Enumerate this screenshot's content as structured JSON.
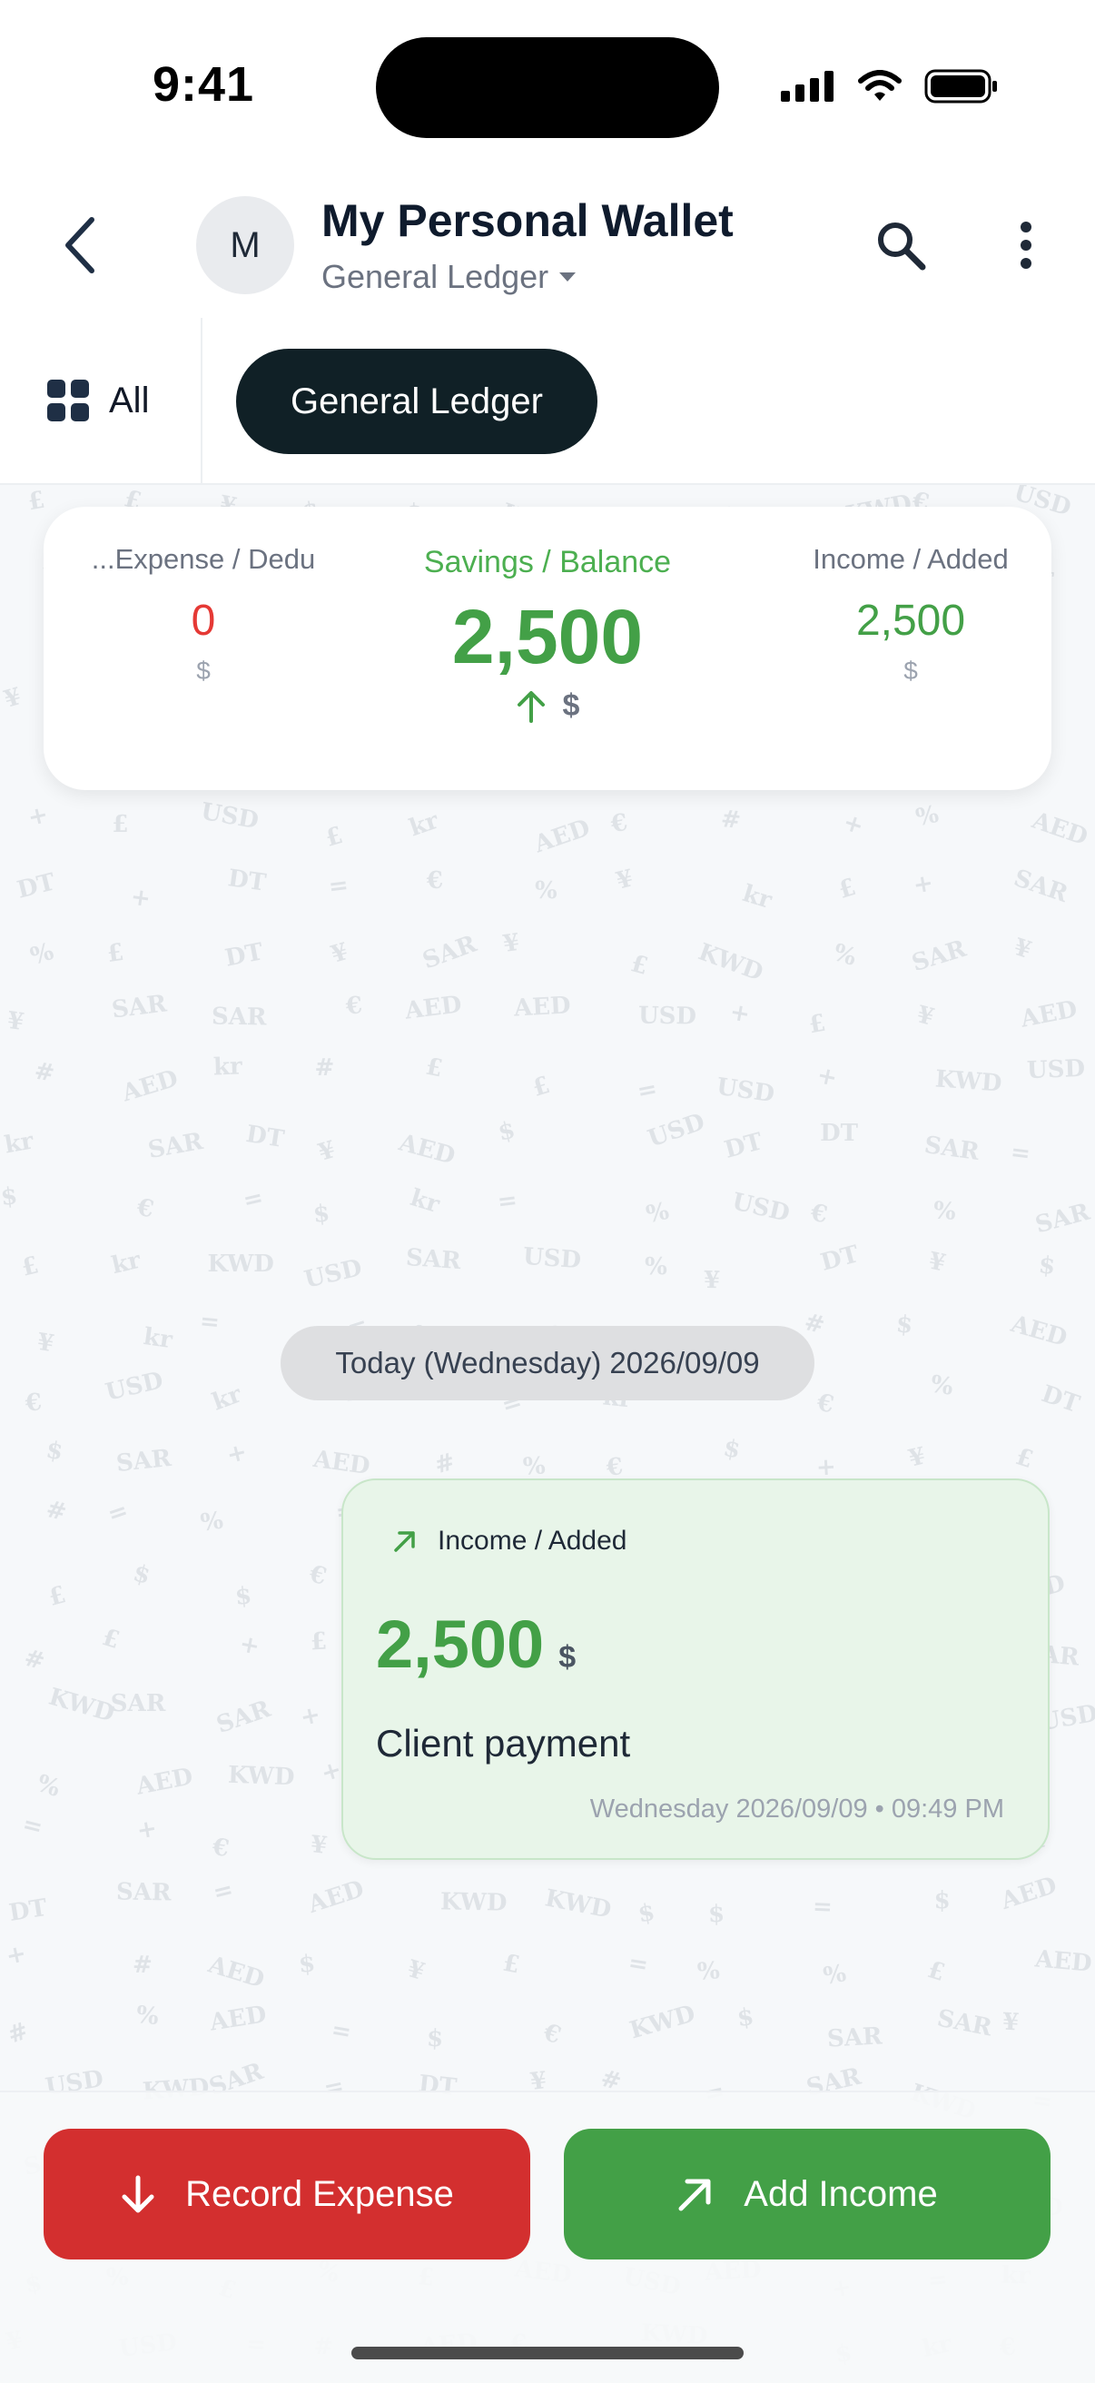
{
  "status_bar": {
    "time": "9:41"
  },
  "header": {
    "avatar_letter": "M",
    "title": "My Personal Wallet",
    "ledger_selector": "General Ledger"
  },
  "tabs": {
    "all_label": "All",
    "active_label": "General Ledger"
  },
  "summary": {
    "expense_label": "...Expense / Dedu",
    "expense_value": "0",
    "expense_currency": "$",
    "savings_label": "Savings / Balance",
    "savings_value": "2,500",
    "savings_currency": "$",
    "income_label": "Income / Added",
    "income_value": "2,500",
    "income_currency": "$"
  },
  "date_chip": "Today (Wednesday) 2026/09/09",
  "transaction": {
    "type": "Income / Added",
    "amount": "2,500",
    "currency": "$",
    "description": "Client payment",
    "meta": "Wednesday 2026/09/09 • 09:49 PM"
  },
  "actions": {
    "expense_label": "Record Expense",
    "income_label": "Add Income"
  },
  "colors": {
    "income": "#43a047",
    "expense": "#d32f2f",
    "active_tab": "#102026"
  }
}
